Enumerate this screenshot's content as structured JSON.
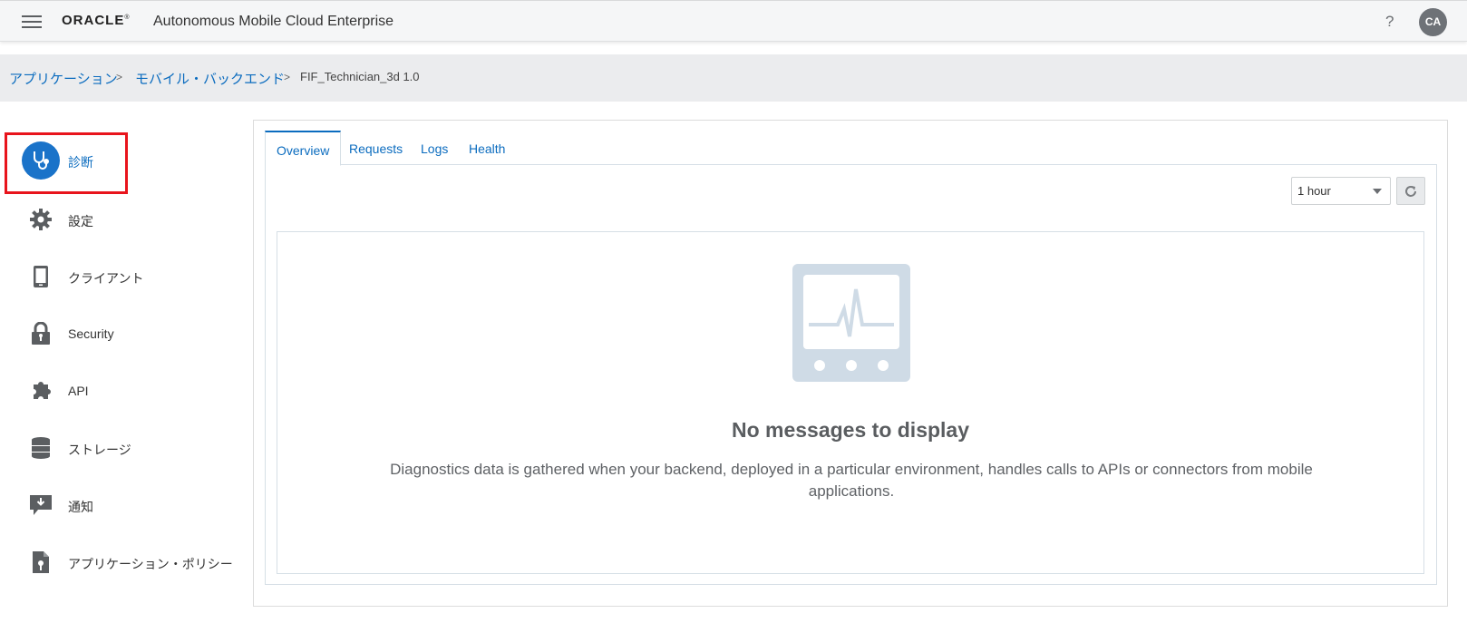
{
  "header": {
    "brand": "ORACLE",
    "product": "Autonomous Mobile Cloud Enterprise",
    "help": "?",
    "avatar_initials": "CA"
  },
  "breadcrumb": {
    "items": [
      "アプリケーション",
      "モバイル・バックエンド"
    ],
    "separator": ">",
    "current": "FIF_Technician_3d  1.0"
  },
  "sidebar": {
    "items": [
      {
        "label": "診断",
        "icon": "stethoscope-icon",
        "active": true
      },
      {
        "label": "設定",
        "icon": "gear-icon"
      },
      {
        "label": "クライアント",
        "icon": "mobile-phone-icon"
      },
      {
        "label": "Security",
        "icon": "lock-icon"
      },
      {
        "label": "API",
        "icon": "puzzle-icon"
      },
      {
        "label": "ストレージ",
        "icon": "database-icon"
      },
      {
        "label": "通知",
        "icon": "notification-icon"
      },
      {
        "label": "アプリケーション・ポリシー",
        "icon": "policy-document-icon"
      }
    ]
  },
  "tabs": [
    "Overview",
    "Requests",
    "Logs",
    "Health"
  ],
  "active_tab": "Overview",
  "time_range": {
    "selected": "1 hour"
  },
  "empty_state": {
    "icon": "heart-monitor-icon",
    "title": "No messages to display",
    "message": "Diagnostics data is gathered when your backend, deployed in a particular environment, handles calls to APIs or connectors from mobile applications."
  },
  "colors": {
    "accent": "#0b6cbf",
    "active_icon_bg": "#1a73c9",
    "highlight": "#e8141c",
    "icon_gray": "#5b5e61",
    "empty_icon": "#cfdbe6"
  }
}
